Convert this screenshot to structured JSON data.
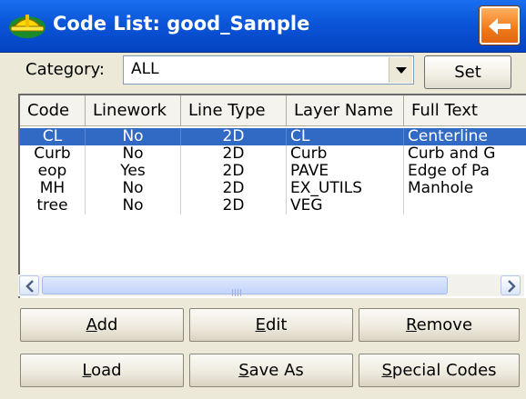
{
  "window": {
    "title": "Code List: good_Sample"
  },
  "category": {
    "label": "Category:",
    "selected": "ALL",
    "set_label": "Set"
  },
  "table": {
    "columns": [
      "Code",
      "Linework",
      "Line Type",
      "Layer Name",
      "Full Text"
    ],
    "rows": [
      {
        "code": "CL",
        "linework": "No",
        "line_type": "2D",
        "layer": "CL",
        "full_text": "Centerline",
        "selected": true
      },
      {
        "code": "Curb",
        "linework": "No",
        "line_type": "2D",
        "layer": "Curb",
        "full_text": "Curb and G",
        "selected": false
      },
      {
        "code": "eop",
        "linework": "Yes",
        "line_type": "2D",
        "layer": "PAVE",
        "full_text": "Edge of Pa",
        "selected": false
      },
      {
        "code": "MH",
        "linework": "No",
        "line_type": "2D",
        "layer": "EX_UTILS",
        "full_text": "Manhole",
        "selected": false
      },
      {
        "code": "tree",
        "linework": "No",
        "line_type": "2D",
        "layer": "VEG",
        "full_text": "",
        "selected": false
      }
    ]
  },
  "buttons": {
    "add": {
      "mnemonic": "A",
      "rest": "dd"
    },
    "edit": {
      "mnemonic": "E",
      "rest": "dit"
    },
    "remove": {
      "mnemonic": "R",
      "rest": "emove"
    },
    "load": {
      "mnemonic": "L",
      "rest": "oad"
    },
    "save_as": {
      "mnemonic": "S",
      "rest": "ave As"
    },
    "special_codes": {
      "pre": "",
      "mnemonic": "S",
      "rest": "pecial Codes"
    }
  },
  "colors": {
    "title_bar": "#0b55d8",
    "back_button": "#f07a1a",
    "selection": "#316ac5",
    "face": "#ece9d8"
  },
  "icons": {
    "app": "hardhat-icon",
    "back": "back-arrow-icon",
    "scroll_left": "arrow-left-icon",
    "scroll_right": "arrow-right-icon",
    "dropdown": "dropdown-arrow-icon"
  }
}
